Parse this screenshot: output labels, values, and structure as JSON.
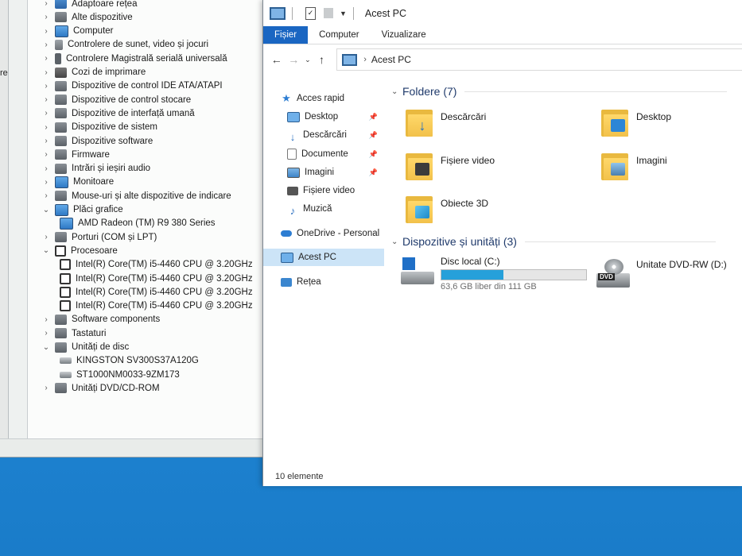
{
  "device_manager": {
    "left_fragment": "re",
    "tree": [
      {
        "label": "Adaptoare rețea",
        "icon": "network-adapter-icon",
        "expanded": false,
        "level": 0
      },
      {
        "label": "Alte dispozitive",
        "icon": "other-devices-icon",
        "expanded": false,
        "level": 0
      },
      {
        "label": "Computer",
        "icon": "computer-icon",
        "expanded": false,
        "level": 0
      },
      {
        "label": "Controlere de sunet, video și jocuri",
        "icon": "sound-icon",
        "expanded": false,
        "level": 0
      },
      {
        "label": "Controlere Magistrală serială universală",
        "icon": "usb-icon",
        "expanded": false,
        "level": 0
      },
      {
        "label": "Cozi de imprimare",
        "icon": "printer-icon",
        "expanded": false,
        "level": 0
      },
      {
        "label": "Dispozitive de control IDE ATA/ATAPI",
        "icon": "ide-icon",
        "expanded": false,
        "level": 0
      },
      {
        "label": "Dispozitive de control stocare",
        "icon": "storage-controller-icon",
        "expanded": false,
        "level": 0
      },
      {
        "label": "Dispozitive de interfață umană",
        "icon": "hid-icon",
        "expanded": false,
        "level": 0
      },
      {
        "label": "Dispozitive de sistem",
        "icon": "system-devices-icon",
        "expanded": false,
        "level": 0
      },
      {
        "label": "Dispozitive software",
        "icon": "software-devices-icon",
        "expanded": false,
        "level": 0
      },
      {
        "label": "Firmware",
        "icon": "firmware-icon",
        "expanded": false,
        "level": 0
      },
      {
        "label": "Intrări și ieșiri audio",
        "icon": "audio-io-icon",
        "expanded": false,
        "level": 0
      },
      {
        "label": "Monitoare",
        "icon": "monitor-icon",
        "expanded": false,
        "level": 0
      },
      {
        "label": "Mouse-uri și alte dispozitive de indicare",
        "icon": "mouse-icon",
        "expanded": false,
        "level": 0
      },
      {
        "label": "Plăci grafice",
        "icon": "display-adapter-icon",
        "expanded": true,
        "level": 0
      },
      {
        "label": "AMD Radeon (TM) R9 380 Series",
        "icon": "gpu-icon",
        "level": 1
      },
      {
        "label": "Porturi (COM și LPT)",
        "icon": "ports-icon",
        "expanded": false,
        "level": 0
      },
      {
        "label": "Procesoare",
        "icon": "processor-icon",
        "expanded": true,
        "level": 0
      },
      {
        "label": "Intel(R) Core(TM) i5-4460  CPU @ 3.20GHz",
        "icon": "cpu-icon",
        "level": 1
      },
      {
        "label": "Intel(R) Core(TM) i5-4460  CPU @ 3.20GHz",
        "icon": "cpu-icon",
        "level": 1
      },
      {
        "label": "Intel(R) Core(TM) i5-4460  CPU @ 3.20GHz",
        "icon": "cpu-icon",
        "level": 1
      },
      {
        "label": "Intel(R) Core(TM) i5-4460  CPU @ 3.20GHz",
        "icon": "cpu-icon",
        "level": 1
      },
      {
        "label": "Software components",
        "icon": "software-components-icon",
        "expanded": false,
        "level": 0
      },
      {
        "label": "Tastaturi",
        "icon": "keyboard-icon",
        "expanded": false,
        "level": 0
      },
      {
        "label": "Unități de disc",
        "icon": "disk-drives-icon",
        "expanded": true,
        "level": 0
      },
      {
        "label": "KINGSTON SV300S37A120G",
        "icon": "disk-icon",
        "level": 1
      },
      {
        "label": "ST1000NM0033-9ZM173",
        "icon": "disk-icon",
        "level": 1
      },
      {
        "label": "Unități DVD/CD-ROM",
        "icon": "dvd-drive-icon",
        "expanded": false,
        "level": 0
      }
    ]
  },
  "explorer": {
    "title": "Acest PC",
    "tabs": [
      "Fișier",
      "Computer",
      "Vizualizare"
    ],
    "address": "Acest PC",
    "nav": [
      {
        "label": "Acces rapid",
        "icon": "star-icon",
        "pinned": false
      },
      {
        "label": "Desktop",
        "icon": "desktop-icon",
        "pinned": true
      },
      {
        "label": "Descărcări",
        "icon": "download-icon",
        "pinned": true
      },
      {
        "label": "Documente",
        "icon": "documents-icon",
        "pinned": true
      },
      {
        "label": "Imagini",
        "icon": "pictures-icon",
        "pinned": true
      },
      {
        "label": "Fișiere video",
        "icon": "videos-icon",
        "pinned": false
      },
      {
        "label": "Muzică",
        "icon": "music-icon",
        "pinned": false
      },
      {
        "label": "OneDrive - Personal",
        "icon": "cloud-icon",
        "pinned": false
      },
      {
        "label": "Acest PC",
        "icon": "pc-icon",
        "pinned": false,
        "selected": true
      },
      {
        "label": "Rețea",
        "icon": "network-icon",
        "pinned": false
      }
    ],
    "folders_header": "Foldere (7)",
    "folders": [
      {
        "label": "Descărcări",
        "icon": "downloads-folder-icon"
      },
      {
        "label": "Desktop",
        "icon": "desktop-folder-icon"
      },
      {
        "label": "Fișiere video",
        "icon": "videos-folder-icon"
      },
      {
        "label": "Imagini",
        "icon": "pictures-folder-icon"
      },
      {
        "label": "Obiecte 3D",
        "icon": "3d-objects-folder-icon"
      }
    ],
    "devices_header": "Dispozitive și unități (3)",
    "drives": [
      {
        "label": "Disc local (C:)",
        "icon": "local-disk-icon",
        "space": "63,6 GB liber din 111 GB",
        "used_fraction": 0.43
      },
      {
        "label": "Unitate DVD-RW (D:)",
        "icon": "dvd-drive-icon",
        "dvd_badge": "DVD"
      }
    ],
    "status": "10 elemente"
  },
  "colors": {
    "accent": "#1a66c2",
    "selection": "#cce4f7",
    "progress": "#26a0da",
    "desktop": "#2c8fd9"
  }
}
